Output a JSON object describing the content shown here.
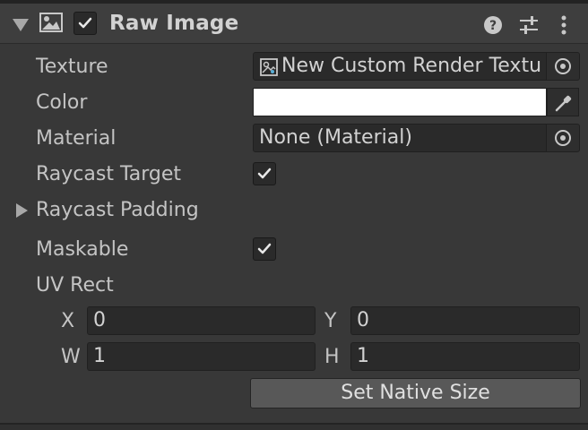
{
  "header": {
    "title": "Raw Image",
    "enabled": true
  },
  "fields": {
    "texture_label": "Texture",
    "texture_value": "New Custom Render Textu",
    "color_label": "Color",
    "color_value": "#ffffff",
    "material_label": "Material",
    "material_value": "None (Material)",
    "raycast_target_label": "Raycast Target",
    "raycast_target_checked": true,
    "raycast_padding_label": "Raycast Padding",
    "maskable_label": "Maskable",
    "maskable_checked": true,
    "uv_rect_label": "UV Rect"
  },
  "uv_rect": {
    "x_label": "X",
    "x_value": "0",
    "y_label": "Y",
    "y_value": "0",
    "w_label": "W",
    "w_value": "1",
    "h_label": "H",
    "h_value": "1"
  },
  "actions": {
    "set_native_size_label": "Set Native Size"
  },
  "icons": {
    "foldout": "triangle-down-icon",
    "component": "image-icon",
    "help": "help-icon",
    "presets": "sliders-icon",
    "menu": "kebab-menu-icon",
    "texture_asset": "render-texture-icon",
    "object_picker": "object-picker-icon",
    "eyedropper": "eyedropper-icon",
    "foldout_collapsed": "triangle-right-icon"
  },
  "colors": {
    "background": "#383838",
    "header": "#3e3e3e",
    "field": "#2a2a2a",
    "text": "#c4c4c4",
    "button": "#585858"
  }
}
